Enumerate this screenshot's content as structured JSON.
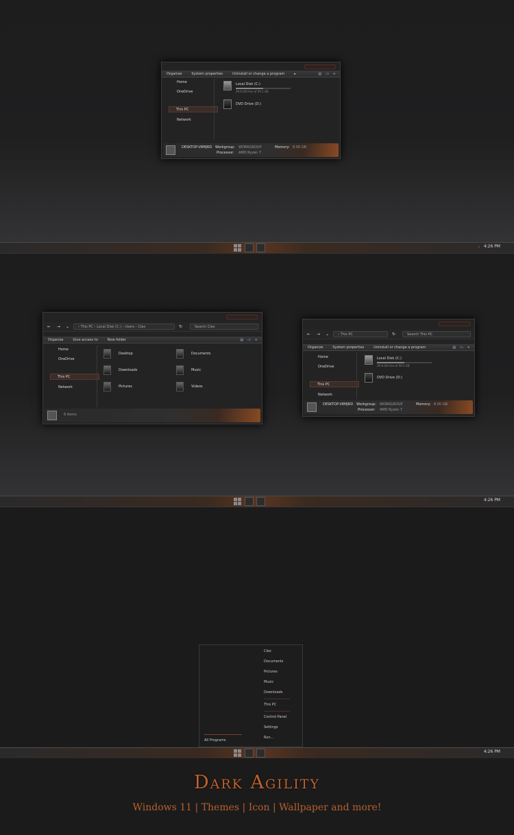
{
  "colors": {
    "accent": "#c0622a",
    "window_bg": "#232323",
    "desktop_bg": "#1d1d1e"
  },
  "taskbar": {
    "clock": "4:26 PM"
  },
  "thispc_window": {
    "cmdbar": {
      "organize": "Organize",
      "system_properties": "System properties",
      "uninstall": "Uninstall or change a program",
      "more": "▸"
    },
    "nav": {
      "home": "Home",
      "onedrive": "OneDrive",
      "thispc": "This PC",
      "network": "Network"
    },
    "drives": [
      {
        "name": "Local Disk (C:)",
        "size": "29.8 GB free of 59.2 GB",
        "used_fraction": 0.5
      },
      {
        "name": "DVD Drive (D:)"
      }
    ],
    "details": {
      "computer": "DESKTOP-V8MJRD",
      "workgroup_label": "Workgroup:",
      "workgroup": "WORKGROUP",
      "memory_label": "Memory:",
      "memory": "8.00 GB",
      "processor_label": "Processor:",
      "processor": "AMD Ryzen 7"
    }
  },
  "user_window": {
    "address": {
      "path": "› This PC › Local Disk (C:) › Users › Clex",
      "search": "Search Clex"
    },
    "cmdbar": {
      "organize": "Organize",
      "give_access": "Give access to",
      "new_folder": "New folder"
    },
    "nav": {
      "home": "Home",
      "onedrive": "OneDrive",
      "thispc": "This PC",
      "network": "Network"
    },
    "folders": [
      "Desktop",
      "Documents",
      "Downloads",
      "Music",
      "Pictures",
      "Videos"
    ],
    "status": "6 items"
  },
  "thispc_window2": {
    "address": {
      "path": "› This PC",
      "search": "Search This PC"
    },
    "cmdbar": {
      "organize": "Organize",
      "system_properties": "System properties",
      "uninstall": "Uninstall or change a program"
    },
    "nav": {
      "home": "Home",
      "onedrive": "OneDrive",
      "thispc": "This PC",
      "network": "Network"
    },
    "drives": [
      {
        "name": "Local Disk (C:)",
        "size": "29.8 GB free of 59.2 GB"
      },
      {
        "name": "DVD Drive (D:)"
      }
    ],
    "details": {
      "computer": "DESKTOP-V8MJRD",
      "workgroup_label": "Workgroup:",
      "workgroup": "WORKGROUP",
      "memory_label": "Memory:",
      "memory": "8.00 GB",
      "processor_label": "Processor:",
      "processor": "AMD Ryzen 7"
    }
  },
  "start_menu": {
    "items": [
      "Clex",
      "Documents",
      "Pictures",
      "Music",
      "Downloads",
      "This PC",
      "Control Panel",
      "Settings",
      "Run..."
    ],
    "all_programs": "All Programs"
  },
  "brand": {
    "title": "Dark Agility",
    "subtitle": "Windows 11 | Themes | Icon | Wallpaper and more!"
  }
}
